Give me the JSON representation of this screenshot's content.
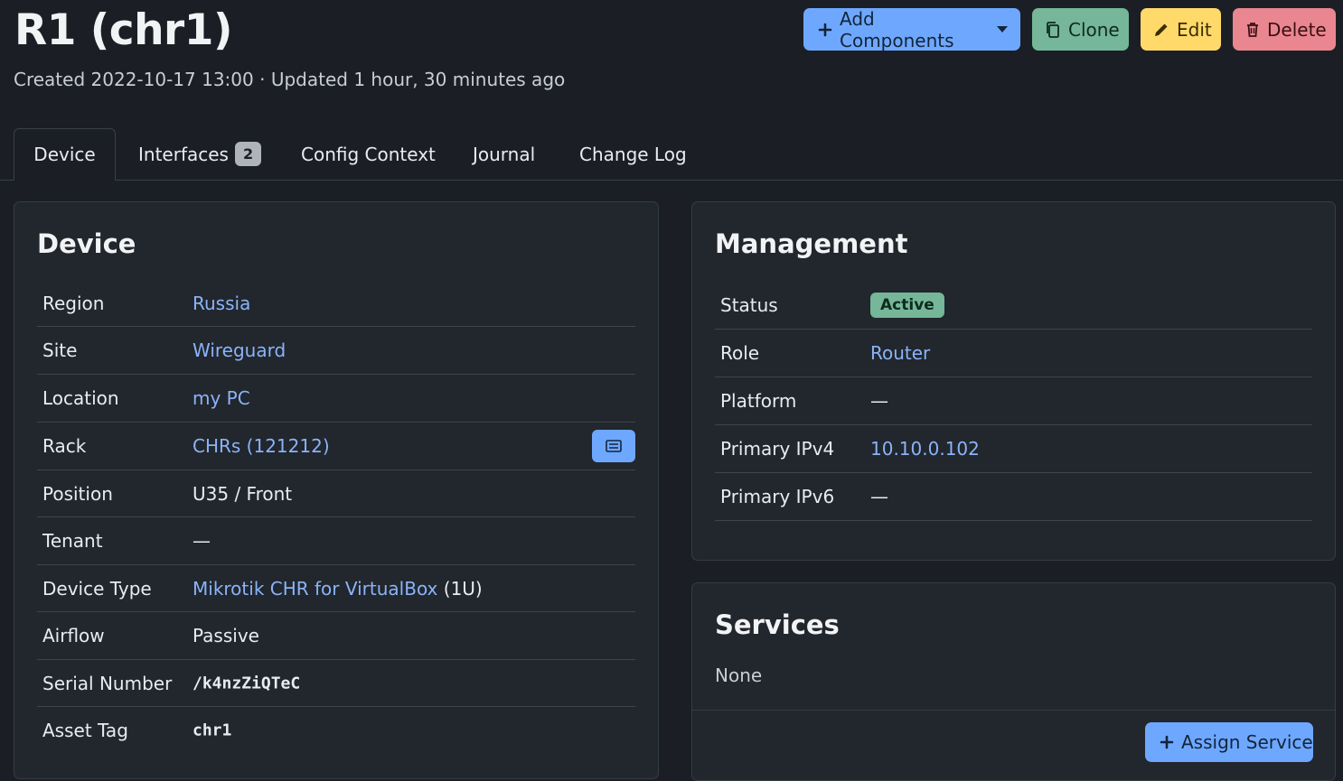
{
  "header": {
    "title": "R1 (chr1)",
    "created_label": "Created",
    "created": "2022-10-17 13:00",
    "separator": "·",
    "updated_label": "Updated",
    "updated": "1 hour, 30 minutes ago"
  },
  "actions": {
    "add_components": "Add Components",
    "clone": "Clone",
    "edit": "Edit",
    "delete": "Delete"
  },
  "tabs": [
    {
      "label": "Device",
      "active": true
    },
    {
      "label": "Interfaces",
      "count": "2"
    },
    {
      "label": "Config Context"
    },
    {
      "label": "Journal"
    },
    {
      "label": "Change Log"
    }
  ],
  "device": {
    "title": "Device",
    "rows": [
      {
        "label": "Region",
        "value": "Russia"
      },
      {
        "label": "Site",
        "value": "Wireguard"
      },
      {
        "label": "Location",
        "value": "my PC"
      },
      {
        "label": "Rack",
        "value": "CHRs (121212)"
      },
      {
        "label": "Position",
        "value": "U35 / Front"
      },
      {
        "label": "Tenant",
        "value": "—"
      },
      {
        "label": "Device Type",
        "value": "Mikrotik CHR for VirtualBox",
        "suffix": "(1U)"
      },
      {
        "label": "Airflow",
        "value": "Passive"
      },
      {
        "label": "Serial Number",
        "value": "/k4nzZiQTeC"
      },
      {
        "label": "Asset Tag",
        "value": "chr1"
      }
    ]
  },
  "management": {
    "title": "Management",
    "rows": [
      {
        "label": "Status",
        "value": "Active"
      },
      {
        "label": "Role",
        "value": "Router"
      },
      {
        "label": "Platform",
        "value": "—"
      },
      {
        "label": "Primary IPv4",
        "value": "10.10.0.102"
      },
      {
        "label": "Primary IPv6",
        "value": "—"
      }
    ]
  },
  "services": {
    "title": "Services",
    "empty_text": "None",
    "assign_button": "Assign Service"
  },
  "colors": {
    "primary": "#6ea8fe",
    "success": "#75b798",
    "warning": "#ffda6a",
    "danger": "#ea868f",
    "link": "#8ab4f8",
    "background": "#1b1f25",
    "card": "#22262d"
  },
  "icons": {
    "add": "plus-icon",
    "clone": "clone-icon",
    "edit": "pencil-icon",
    "delete": "trash-icon",
    "rack": "rack-icon"
  }
}
